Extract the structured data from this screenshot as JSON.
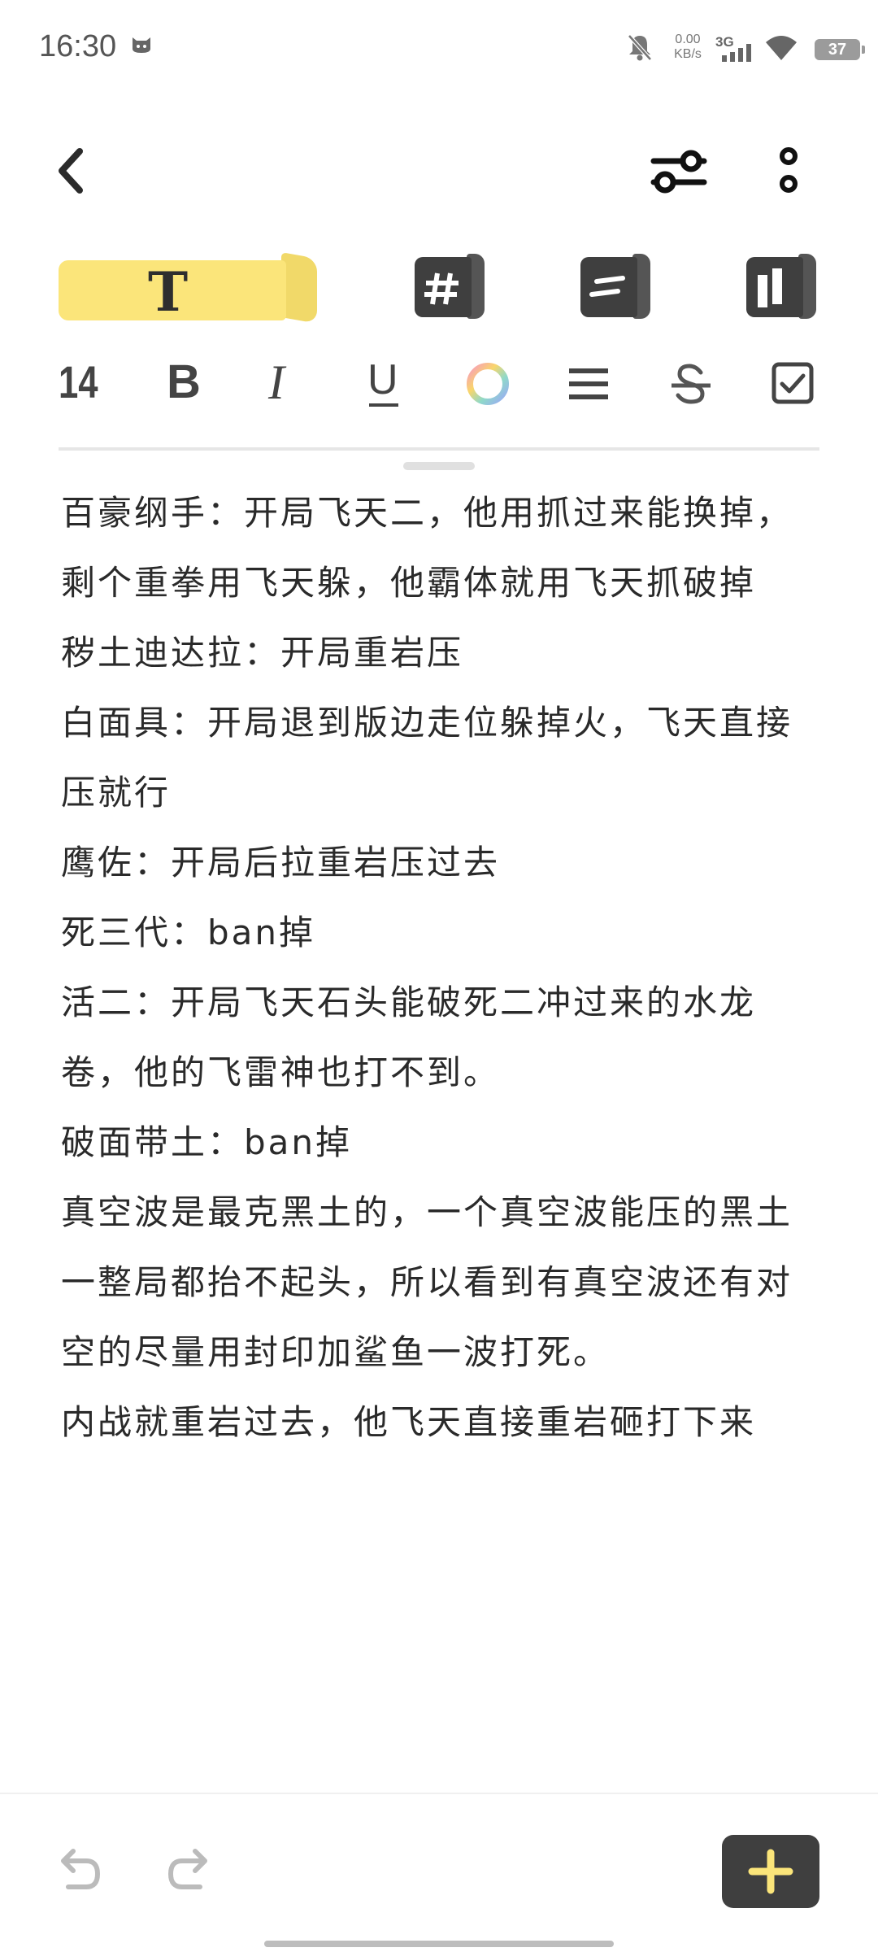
{
  "status": {
    "time": "16:30",
    "net_speed_value": "0.00",
    "net_speed_unit": "KB/s",
    "network": "3G",
    "battery": "37"
  },
  "toolbar": {
    "text_mode_label": "T",
    "font_size": "14",
    "bold_label": "B",
    "italic_label": "I",
    "underline_label": "U"
  },
  "icons": {
    "back": "chevron-left-icon",
    "filter": "sliders-icon",
    "more": "more-vertical-icon",
    "tag": "hashtag-icon",
    "list": "list-block-icon",
    "layout": "columns-icon",
    "color": "color-wheel-icon",
    "align": "align-icon",
    "strike": "strikethrough-icon",
    "checklist": "checkbox-icon",
    "undo": "undo-icon",
    "redo": "redo-icon",
    "add": "plus-icon"
  },
  "colors": {
    "accent": "#fbe57a",
    "dark_button": "#3f3f3f",
    "plus": "#fbe57a"
  },
  "note": {
    "paragraphs": [
      "百豪纲手：开局飞天二，他用抓过来能换掉，剩个重拳用飞天躲，他霸体就用飞天抓破掉",
      "秽土迪达拉：开局重岩压",
      "白面具：开局退到版边走位躲掉火，飞天直接压就行",
      "鹰佐：开局后拉重岩压过去",
      "死三代：ban掉",
      "活二：开局飞天石头能破死二冲过来的水龙卷，他的飞雷神也打不到。",
      "破面带土：ban掉",
      "真空波是最克黑土的，一个真空波能压的黑土一整局都抬不起头，所以看到有真空波还有对空的尽量用封印加鲨鱼一波打死。",
      "内战就重岩过去，他飞天直接重岩砸打下来"
    ]
  }
}
